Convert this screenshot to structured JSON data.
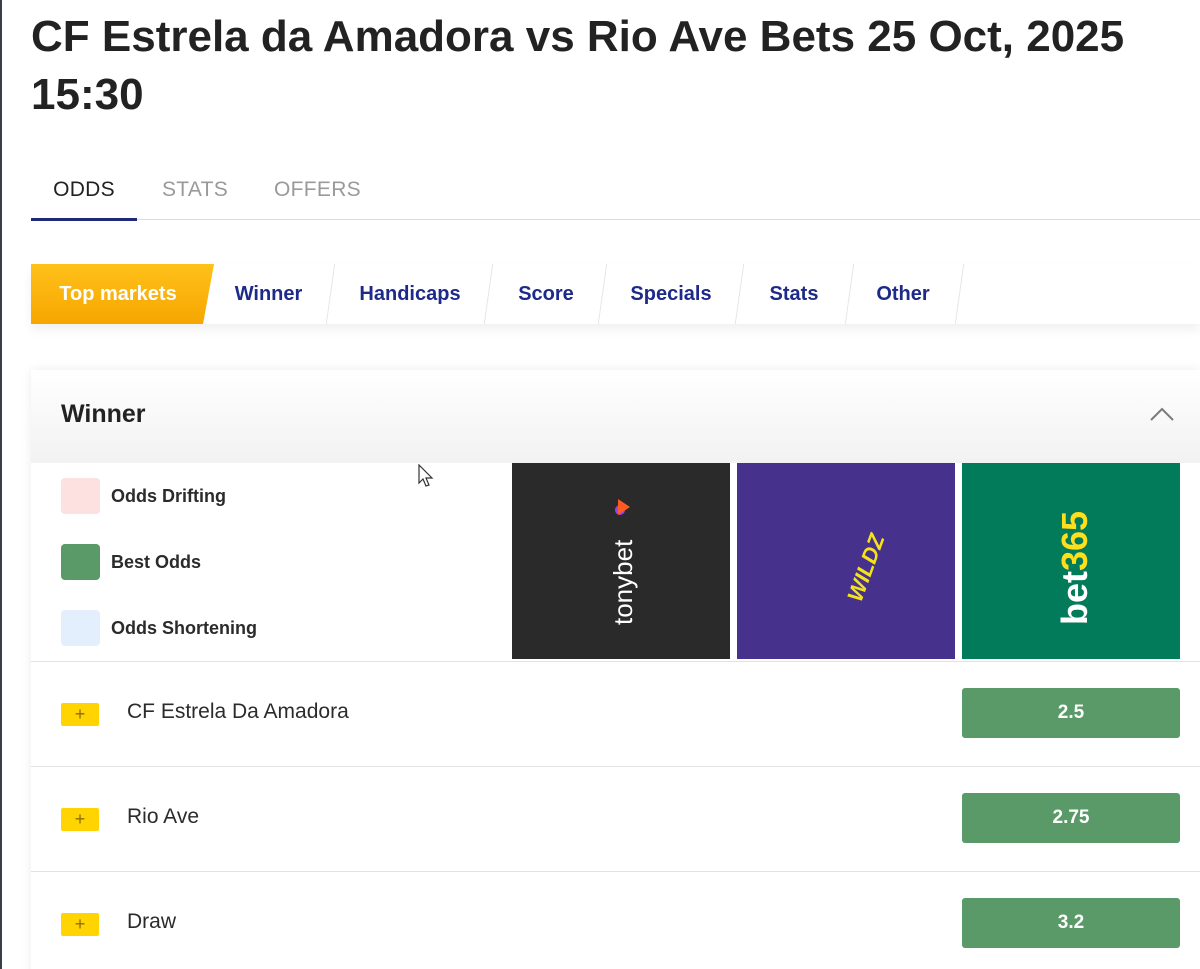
{
  "page": {
    "title_line1": "CF Estrela da Amadora vs Rio Ave Bets 25 Oct, 2025",
    "title_line2": "15:30"
  },
  "main_tabs": [
    {
      "label": "ODDS",
      "active": true
    },
    {
      "label": "STATS",
      "active": false
    },
    {
      "label": "OFFERS",
      "active": false
    }
  ],
  "market_tabs": [
    {
      "label": "Top markets",
      "active": true
    },
    {
      "label": "Winner",
      "active": false
    },
    {
      "label": "Handicaps",
      "active": false
    },
    {
      "label": "Score",
      "active": false
    },
    {
      "label": "Specials",
      "active": false
    },
    {
      "label": "Stats",
      "active": false
    },
    {
      "label": "Other",
      "active": false
    }
  ],
  "winner_panel": {
    "title": "Winner",
    "collapse_icon": "chevron-up-icon",
    "legend": [
      {
        "label": "Odds Drifting",
        "color": "#fde0e0"
      },
      {
        "label": "Best Odds",
        "color": "#5a9a68"
      },
      {
        "label": "Odds Shortening",
        "color": "#e3effc"
      }
    ],
    "bookmakers": [
      {
        "name": "tonybet",
        "bg": "#2a2a2a",
        "text_color": "#ffffff",
        "accent": "#ff5a1f"
      },
      {
        "name": "WILDZ",
        "bg": "#46318d",
        "text_color": "#f5e31a"
      },
      {
        "name": "bet365",
        "bg": "#027b5b",
        "text_color": "#ffffff",
        "accent": "#ffdf1b"
      }
    ],
    "outcomes": [
      {
        "name": "CF Estrela Da Amadora",
        "odds": "2.5",
        "best": true
      },
      {
        "name": "Rio Ave",
        "odds": "2.75",
        "best": true
      },
      {
        "name": "Draw",
        "odds": "3.2",
        "best": true
      }
    ],
    "expand_symbol": "+"
  },
  "colors": {
    "accent_orange": "#f7a600",
    "nav_blue": "#1e2a8a",
    "best_odds_green": "#5a9a68",
    "expand_yellow": "#ffd400"
  }
}
